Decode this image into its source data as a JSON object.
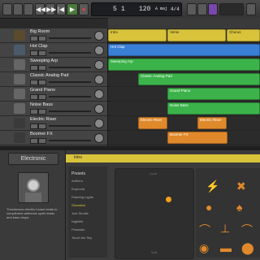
{
  "control_bar": {
    "lcd": {
      "bar": "5",
      "beat": "1",
      "tempo": "120",
      "key": "A maj",
      "time_sig": "4/4"
    }
  },
  "tracks": [
    {
      "name": "Big Room",
      "color": "#d9c33b"
    },
    {
      "name": "Hot Clap",
      "color": "#3a7fd6"
    },
    {
      "name": "Sweeping Arp",
      "color": "#3cb34a"
    },
    {
      "name": "Classic Analog Pad",
      "color": "#3cb34a"
    },
    {
      "name": "Grand Piano",
      "color": "#3cb34a"
    },
    {
      "name": "Noise Bass",
      "color": "#3cb34a"
    },
    {
      "name": "Electric Riser",
      "color": "#e0892b"
    },
    {
      "name": "Boomer FX",
      "color": "#e0892b"
    }
  ],
  "arrangement_markers": [
    "Intro",
    "Verse",
    "Chorus"
  ],
  "regions": [
    {
      "label": "Intro",
      "lane": 0,
      "type": "yellow"
    },
    {
      "label": "Verse",
      "lane": 0,
      "type": "yellow"
    },
    {
      "label": "Chorus",
      "lane": 0,
      "type": "yellow"
    },
    {
      "label": "Hot Clap",
      "lane": 1,
      "type": "blue"
    },
    {
      "label": "Sweeping Arp",
      "lane": 2,
      "type": "green"
    },
    {
      "label": "Classic Analog Pad",
      "lane": 3,
      "type": "green"
    },
    {
      "label": "Grand Piano",
      "lane": 4,
      "type": "green"
    },
    {
      "label": "Noise Bass",
      "lane": 5,
      "type": "green"
    },
    {
      "label": "Electric Riser",
      "lane": 6,
      "type": "orange"
    },
    {
      "label": "Electric Riser",
      "lane": 6,
      "type": "orange"
    },
    {
      "label": "Boomer FX",
      "lane": 7,
      "type": "orange"
    }
  ],
  "library": {
    "title": "Electronic",
    "description": "Thunderous electric house beats to compliment anthemic synth leads and bass drops."
  },
  "editor": {
    "header": "Intro",
    "presets_title": "Presets",
    "presets": [
      "Anthem",
      "Euphoria",
      "Flashing Lights",
      "Glowstick",
      "Just Shuffle",
      "Nightlife",
      "Prismatic",
      "Touch the Sky"
    ],
    "selected_preset": "Glowstick",
    "xy_top_label": "Loud",
    "xy_bottom_label": "Soft"
  }
}
